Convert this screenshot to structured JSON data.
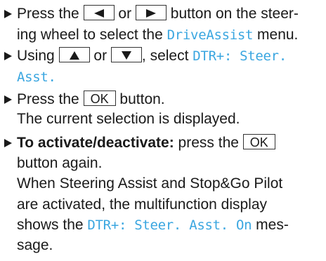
{
  "steps": [
    {
      "l1_a": "Press the",
      "key_left": "left-triangle-icon",
      "l1_b": "or",
      "key_right": "right-triangle-icon",
      "l1_c": "button on the steer-",
      "l2_a": "ing wheel to select the",
      "l2_display": "DriveAssist",
      "l2_b": "menu."
    },
    {
      "l1_a": "Using",
      "key_up": "up-triangle-icon",
      "l1_b": "or",
      "key_down": "down-triangle-icon",
      "l1_c": ", select",
      "l1_display": "DTR+: Steer.",
      "l2_display": "Asst."
    },
    {
      "l1_a": "Press the",
      "key_label": "OK",
      "l1_b": "button.",
      "l2": "The current selection is displayed."
    },
    {
      "l1_bold": "To activate/deactivate:",
      "l1_a": "press the",
      "key_label": "OK",
      "l2": "button again.",
      "l3": "When Steering Assist and Stop&Go Pilot",
      "l4": "are activated, the multifunction display",
      "l5_a": "shows the",
      "l5_display": "DTR+: Steer. Asst. On",
      "l5_b": "mes-",
      "l6": "sage."
    }
  ],
  "colors": {
    "display_text": "#3aa6e0",
    "body_text": "#1a1a1a"
  }
}
